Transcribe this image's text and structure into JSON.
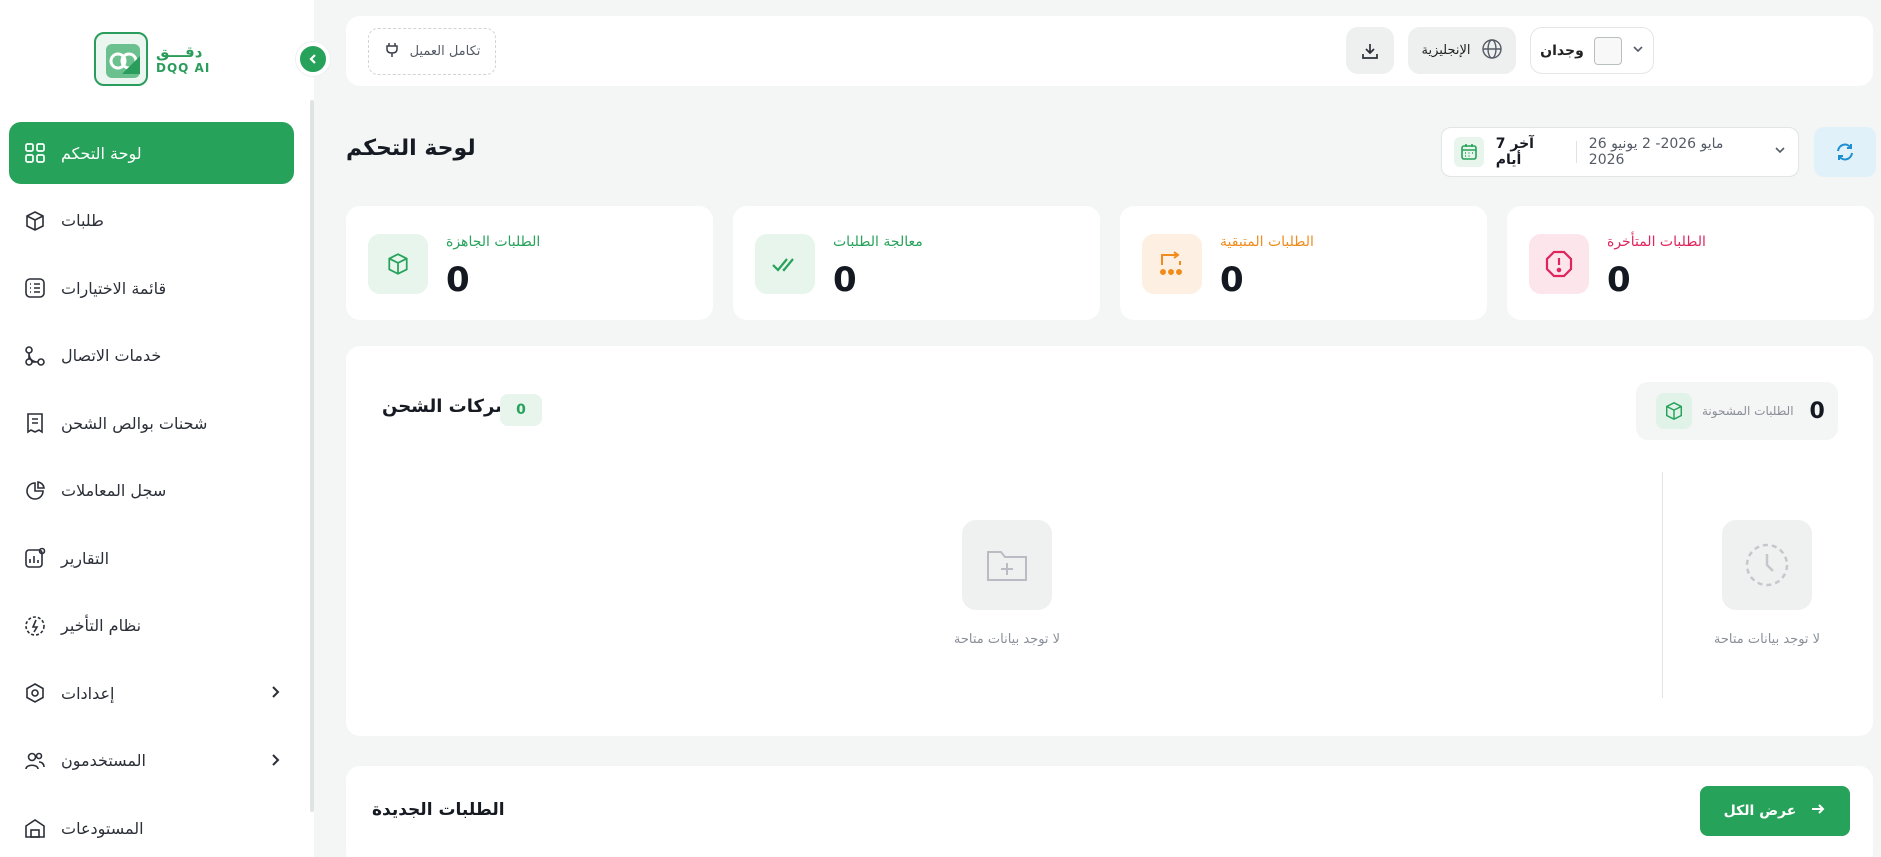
{
  "brand": {
    "name_ar": "دقـــق",
    "name_en": "DQQ AI",
    "color": "#27a25a"
  },
  "sidebar": {
    "items": [
      {
        "label": "لوحة التحكم",
        "icon": "dashboard-grid-icon",
        "active": true
      },
      {
        "label": "طلبات",
        "icon": "box-icon"
      },
      {
        "label": "قائمة الاختيارات",
        "icon": "checklist-icon"
      },
      {
        "label": "خدمات الاتصال",
        "icon": "connection-icon"
      },
      {
        "label": "شحنات بوالص الشحن",
        "icon": "receipt-icon"
      },
      {
        "label": "سجل المعاملات",
        "icon": "pie-chart-icon"
      },
      {
        "label": "التقارير",
        "icon": "report-icon"
      },
      {
        "label": "نظام التأخير",
        "icon": "compass-icon"
      },
      {
        "label": "إعدادات",
        "icon": "settings-icon",
        "has_children": true
      },
      {
        "label": "المستخدمون",
        "icon": "users-icon",
        "has_children": true
      },
      {
        "label": "المستودعات",
        "icon": "warehouse-icon"
      }
    ]
  },
  "topbar": {
    "integration_label": "تكامل العميل",
    "language_label": "الإنجليزية",
    "user_name": "وجدان"
  },
  "page": {
    "title": "لوحة التحكم"
  },
  "date_filter": {
    "preset": "آخر 7 أيام",
    "range": "26 مايو 2026- 2 يونيو 2026"
  },
  "stats": [
    {
      "label": "الطلبات الجاهزة",
      "value": "0",
      "color": "#27a25a",
      "bg": "#e7f5ec",
      "icon": "box-icon"
    },
    {
      "label": "معالجة الطلبات",
      "value": "0",
      "color": "#27a25a",
      "bg": "#e7f5ec",
      "icon": "double-check-icon"
    },
    {
      "label": "الطلبات المتبقية",
      "value": "0",
      "color": "#f08c1e",
      "bg": "#fdf0e2",
      "icon": "remaining-icon"
    },
    {
      "label": "الطلبات المتأخرة",
      "value": "0",
      "color": "#e0245e",
      "bg": "#fce6ec",
      "icon": "alert-octagon-icon"
    }
  ],
  "shipping": {
    "title": "شركات الشحن",
    "count": "0",
    "shipped_label": "الطلبات المشحونة",
    "shipped_value": "0",
    "empty_left": "لا توجد بيانات متاحة",
    "empty_right": "لا توجد بيانات متاحة"
  },
  "new_orders": {
    "title": "الطلبات الجديدة",
    "view_all": "عرض الكل"
  }
}
